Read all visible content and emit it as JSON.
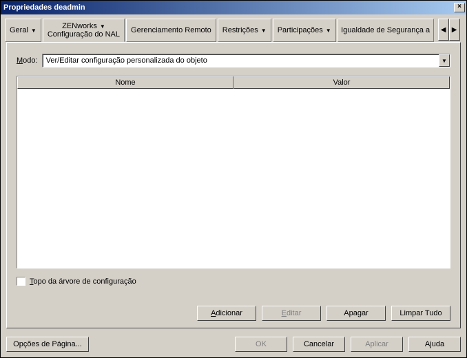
{
  "window": {
    "title": "Propriedades deadmin"
  },
  "tabs": {
    "geral": "Geral",
    "zenworks": "ZENworks",
    "zenworks_sub": "Configuração do NAL",
    "gerenciamento": "Gerenciamento Remoto",
    "restricoes": "Restrições",
    "participacoes": "Participações",
    "igualdade": "Igualdade de Segurança a"
  },
  "mode": {
    "label_pre": "M",
    "label_rest": "odo:",
    "value": "Ver/Editar configuração personalizada do objeto"
  },
  "columns": {
    "name": "Nome",
    "value": "Valor"
  },
  "checkbox": {
    "label_u": "T",
    "label_rest": "opo da árvore de configuração"
  },
  "buttons": {
    "adicionar_u": "A",
    "adicionar_rest": "dicionar",
    "editar_u": "E",
    "editar_rest": "ditar",
    "apagar": "Apagar",
    "limpar": "Limpar Tudo",
    "opcoes": "Opções de Página...",
    "ok": "OK",
    "cancelar": "Cancelar",
    "aplicar": "Aplicar",
    "ajuda": "Ajuda"
  }
}
